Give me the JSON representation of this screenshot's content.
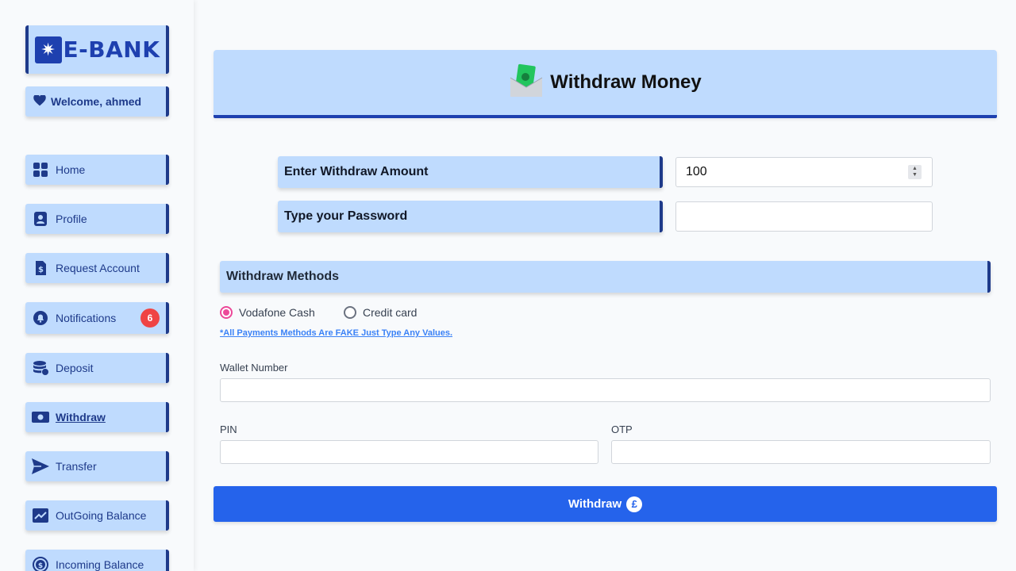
{
  "brand": {
    "name": "E-BANK"
  },
  "welcome": "Welcome, ahmed",
  "nav": [
    {
      "label": "Home",
      "icon": "grid-icon"
    },
    {
      "label": "Profile",
      "icon": "user-badge-icon"
    },
    {
      "label": "Request Account",
      "icon": "document-dollar-icon"
    },
    {
      "label": "Notifications",
      "icon": "bell-icon",
      "badge": "6"
    },
    {
      "label": "Deposit",
      "icon": "coins-icon"
    },
    {
      "label": "Withdraw",
      "icon": "money-bill-icon",
      "active": true
    },
    {
      "label": "Transfer",
      "icon": "paper-plane-icon"
    },
    {
      "label": "OutGoing Balance",
      "icon": "chart-line-icon"
    },
    {
      "label": "Incoming Balance",
      "icon": "dollar-circle-icon"
    }
  ],
  "page": {
    "title": "Withdraw Money",
    "icon": "money-envelope-icon"
  },
  "form": {
    "amount_label": "Enter Withdraw Amount",
    "amount_value": "100",
    "password_label": "Type your Password",
    "password_value": ""
  },
  "methods": {
    "title": "Withdraw Methods",
    "options": [
      "Vodafone Cash",
      "Credit card"
    ],
    "selected": "Vodafone Cash",
    "note": "*All Payments Methods Are FAKE Just Type Any Values."
  },
  "fields": {
    "wallet_label": "Wallet Number",
    "pin_label": "PIN",
    "otp_label": "OTP"
  },
  "submit": {
    "label": "Withdraw",
    "icon": "pound-sign-icon"
  },
  "colors": {
    "card_bg": "#bfdbfe",
    "accent_dark": "#1e3a8a",
    "primary": "#2563eb",
    "badge": "#ef4444",
    "radio_checked": "#ec4899"
  }
}
